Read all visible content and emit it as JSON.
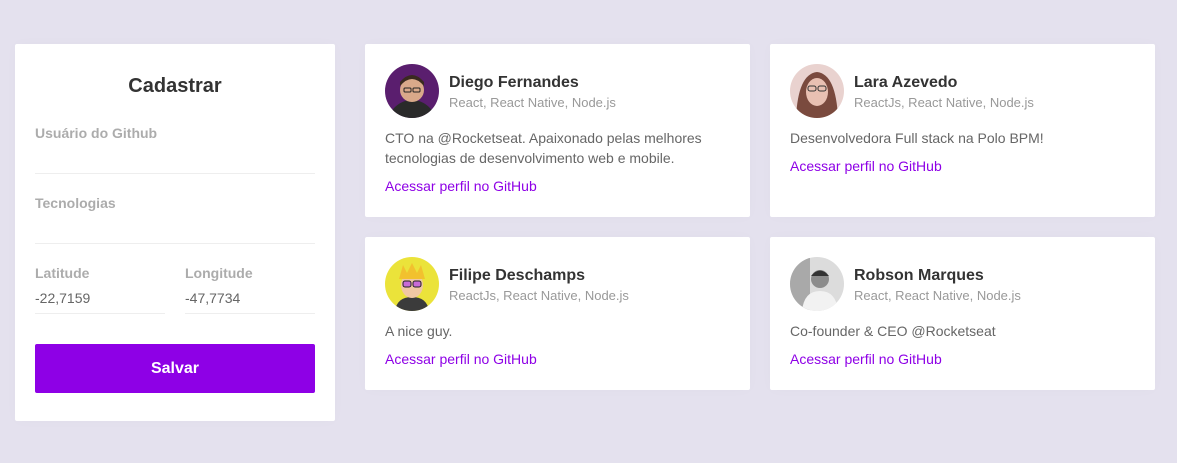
{
  "form": {
    "title": "Cadastrar",
    "github_label": "Usuário do Github",
    "github_value": "",
    "techs_label": "Tecnologias",
    "techs_value": "",
    "latitude_label": "Latitude",
    "latitude_value": "-22,7159",
    "longitude_label": "Longitude",
    "longitude_value": "-47,7734",
    "save_label": "Salvar"
  },
  "devs": [
    {
      "name": "Diego Fernandes",
      "techs": "React, React Native, Node.js",
      "bio": "CTO na @Rocketseat. Apaixonado pelas melhores tecnologias de desenvolvimento web e mobile.",
      "link": "Acessar perfil no GitHub"
    },
    {
      "name": "Lara Azevedo",
      "techs": "ReactJs, React Native, Node.js",
      "bio": "Desenvolvedora Full stack na Polo BPM!",
      "link": "Acessar perfil no GitHub"
    },
    {
      "name": "Filipe Deschamps",
      "techs": "ReactJs, React Native, Node.js",
      "bio": "A nice guy.",
      "link": "Acessar perfil no GitHub"
    },
    {
      "name": "Robson Marques",
      "techs": "React, React Native, Node.js",
      "bio": "Co-founder & CEO @Rocketseat",
      "link": "Acessar perfil no GitHub"
    }
  ],
  "colors": {
    "background": "#e4e1ee",
    "accent": "#8e00e6"
  }
}
